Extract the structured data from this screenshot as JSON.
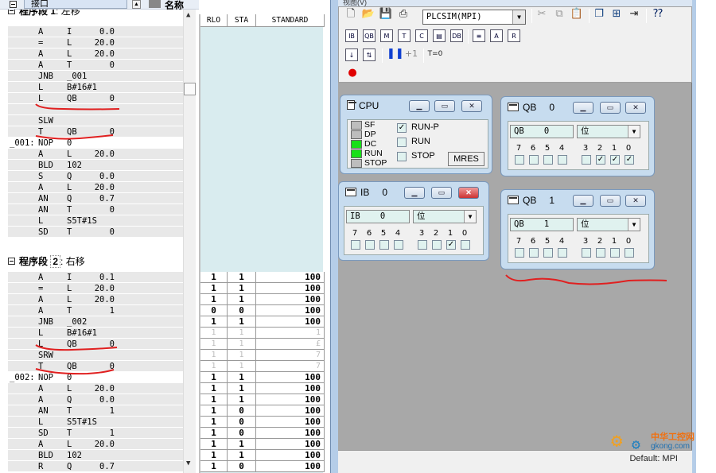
{
  "colors": {
    "accent_red": "#e02020",
    "led_on": "#18e018",
    "led_off": "#bdbdbd",
    "watermark_orange": "#f0a020"
  },
  "editor": {
    "interface_label": "接口",
    "name_label": "名称",
    "segment1": {
      "prefix": "程序段",
      "num": "1",
      "title": "左移"
    },
    "segment2": {
      "prefix": "程序段",
      "num": "2",
      "title": "右移"
    },
    "rows1": [
      {
        "lbl": "",
        "op": "A",
        "a1": "I",
        "a2": "0.0"
      },
      {
        "lbl": "",
        "op": "=",
        "a1": "L",
        "a2": "20.0"
      },
      {
        "lbl": "",
        "op": "A",
        "a1": "L",
        "a2": "20.0"
      },
      {
        "lbl": "",
        "op": "A",
        "a1": "T",
        "a2": "0"
      },
      {
        "lbl": "",
        "op": "JNB",
        "a1": "_001",
        "a2": ""
      },
      {
        "lbl": "",
        "op": "L",
        "a1": "B#16#1",
        "a2": ""
      },
      {
        "lbl": "",
        "op": "L",
        "a1": "QB",
        "a2": "0"
      },
      {
        "lbl": "",
        "op": "",
        "a1": "",
        "a2": ""
      },
      {
        "lbl": "",
        "op": "SLW",
        "a1": "",
        "a2": ""
      },
      {
        "lbl": "",
        "op": "T",
        "a1": "QB",
        "a2": "0"
      },
      {
        "lbl": "_001:",
        "op": "NOP",
        "a1": "0",
        "a2": ""
      },
      {
        "lbl": "",
        "op": "A",
        "a1": "L",
        "a2": "20.0"
      },
      {
        "lbl": "",
        "op": "BLD",
        "a1": "102",
        "a2": ""
      },
      {
        "lbl": "",
        "op": "S",
        "a1": "Q",
        "a2": "0.0"
      },
      {
        "lbl": "",
        "op": "A",
        "a1": "L",
        "a2": "20.0"
      },
      {
        "lbl": "",
        "op": "AN",
        "a1": "Q",
        "a2": "0.7"
      },
      {
        "lbl": "",
        "op": "AN",
        "a1": "T",
        "a2": "0"
      },
      {
        "lbl": "",
        "op": "L",
        "a1": "S5T#1S",
        "a2": ""
      },
      {
        "lbl": "",
        "op": "SD",
        "a1": "T",
        "a2": "0"
      }
    ],
    "rows2": [
      {
        "lbl": "",
        "op": "A",
        "a1": "I",
        "a2": "0.1"
      },
      {
        "lbl": "",
        "op": "=",
        "a1": "L",
        "a2": "20.0"
      },
      {
        "lbl": "",
        "op": "A",
        "a1": "L",
        "a2": "20.0"
      },
      {
        "lbl": "",
        "op": "A",
        "a1": "T",
        "a2": "1"
      },
      {
        "lbl": "",
        "op": "JNB",
        "a1": "_002",
        "a2": ""
      },
      {
        "lbl": "",
        "op": "L",
        "a1": "B#16#1",
        "a2": ""
      },
      {
        "lbl": "",
        "op": "L",
        "a1": "QB",
        "a2": "0"
      },
      {
        "lbl": "",
        "op": "SRW",
        "a1": "",
        "a2": ""
      },
      {
        "lbl": "",
        "op": "T",
        "a1": "QB",
        "a2": "0"
      },
      {
        "lbl": "_002:",
        "op": "NOP",
        "a1": "0",
        "a2": ""
      },
      {
        "lbl": "",
        "op": "A",
        "a1": "L",
        "a2": "20.0"
      },
      {
        "lbl": "",
        "op": "A",
        "a1": "Q",
        "a2": "0.0"
      },
      {
        "lbl": "",
        "op": "AN",
        "a1": "T",
        "a2": "1"
      },
      {
        "lbl": "",
        "op": "L",
        "a1": "S5T#1S",
        "a2": ""
      },
      {
        "lbl": "",
        "op": "SD",
        "a1": "T",
        "a2": "1"
      },
      {
        "lbl": "",
        "op": "A",
        "a1": "L",
        "a2": "20.0"
      },
      {
        "lbl": "",
        "op": "BLD",
        "a1": "102",
        "a2": ""
      },
      {
        "lbl": "",
        "op": "R",
        "a1": "Q",
        "a2": "0.7"
      }
    ]
  },
  "status_table": {
    "headers": [
      "RLO",
      "STA",
      "STANDARD"
    ],
    "rows": [
      {
        "rlo": "1",
        "sta": "1",
        "std": "100",
        "dim": false
      },
      {
        "rlo": "1",
        "sta": "1",
        "std": "100",
        "dim": false
      },
      {
        "rlo": "1",
        "sta": "1",
        "std": "100",
        "dim": false
      },
      {
        "rlo": "0",
        "sta": "0",
        "std": "100",
        "dim": false
      },
      {
        "rlo": "1",
        "sta": "1",
        "std": "100",
        "dim": false
      },
      {
        "rlo": "1",
        "sta": "1",
        "std": "1",
        "dim": true
      },
      {
        "rlo": "1",
        "sta": "1",
        "std": "£",
        "dim": true
      },
      {
        "rlo": "1",
        "sta": "1",
        "std": "7",
        "dim": true
      },
      {
        "rlo": "1",
        "sta": "1",
        "std": "7",
        "dim": true
      },
      {
        "rlo": "1",
        "sta": "1",
        "std": "100",
        "dim": false
      },
      {
        "rlo": "1",
        "sta": "1",
        "std": "100",
        "dim": false
      },
      {
        "rlo": "1",
        "sta": "1",
        "std": "100",
        "dim": false
      },
      {
        "rlo": "1",
        "sta": "0",
        "std": "100",
        "dim": false
      },
      {
        "rlo": "1",
        "sta": "0",
        "std": "100",
        "dim": false
      },
      {
        "rlo": "1",
        "sta": "0",
        "std": "100",
        "dim": false
      },
      {
        "rlo": "1",
        "sta": "1",
        "std": "100",
        "dim": false
      },
      {
        "rlo": "1",
        "sta": "1",
        "std": "100",
        "dim": false
      },
      {
        "rlo": "1",
        "sta": "0",
        "std": "100",
        "dim": false
      }
    ]
  },
  "plcsim": {
    "title": "视图(V)",
    "combo_value": "PLCSIM(MPI)",
    "run_step": "+1",
    "timer_btn": "T=0",
    "status_text": "Default:  MPI",
    "cpu": {
      "title": "CPU",
      "leds": [
        {
          "label": "SF",
          "on": false
        },
        {
          "label": "DP",
          "on": false
        },
        {
          "label": "DC",
          "on": true
        },
        {
          "label": "RUN",
          "on": true
        },
        {
          "label": "STOP",
          "on": false
        }
      ],
      "options": [
        {
          "label": "RUN-P",
          "checked": true
        },
        {
          "label": "RUN",
          "checked": false
        },
        {
          "label": "STOP",
          "checked": false
        }
      ],
      "mres": "MRES"
    },
    "qb0": {
      "title": "QB",
      "num": "0",
      "addr": "QB    0",
      "fmt": "位",
      "checked": [
        false,
        false,
        false,
        false,
        false,
        true,
        true,
        true
      ]
    },
    "ib0": {
      "title": "IB",
      "num": "0",
      "addr": "IB    0",
      "fmt": "位",
      "checked": [
        false,
        false,
        false,
        false,
        false,
        false,
        true,
        false
      ]
    },
    "qb1": {
      "title": "QB",
      "num": "1",
      "addr": "QB    1",
      "fmt": "位",
      "checked": [
        false,
        false,
        false,
        false,
        false,
        false,
        false,
        false
      ]
    },
    "bit_labels": [
      "7",
      "6",
      "5",
      "4",
      "3",
      "2",
      "1",
      "0"
    ],
    "watermark": {
      "cn": "中华工控网",
      "url": "gkong.com"
    }
  }
}
